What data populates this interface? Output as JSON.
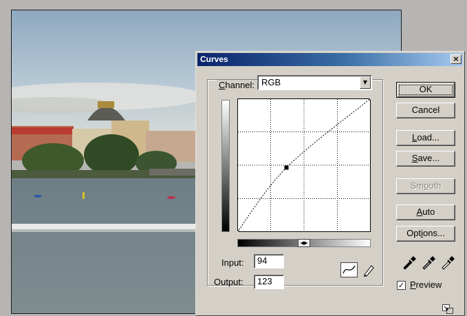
{
  "dialog": {
    "title": "Curves",
    "close_glyph": "×",
    "channel": {
      "label_prefix": "",
      "label_mnemonic": "C",
      "label_rest": "hannel:",
      "value": "RGB",
      "dropdown_glyph": "▼"
    },
    "input": {
      "label": "Input:",
      "value": "94"
    },
    "output": {
      "label": "Output:",
      "value": "123"
    },
    "gradient_toggle_glyph": "◀▶",
    "buttons": {
      "ok": "OK",
      "cancel": "Cancel",
      "load": {
        "mnemonic": "L",
        "rest": "oad..."
      },
      "save": {
        "mnemonic": "S",
        "rest": "ave..."
      },
      "smooth": {
        "pre": "Sm",
        "mnemonic": "o",
        "rest": "oth"
      },
      "auto": {
        "mnemonic": "A",
        "rest": "uto"
      },
      "options": {
        "pre": "Opt",
        "mnemonic": "i",
        "rest": "ons..."
      }
    },
    "preview": {
      "mnemonic": "P",
      "rest": "review",
      "checked": true,
      "check_glyph": "✓"
    },
    "curve_points": [
      {
        "input": 0,
        "output": 0
      },
      {
        "input": 94,
        "output": 123
      },
      {
        "input": 255,
        "output": 255
      }
    ],
    "icons": {
      "curve_tool": "curve-tool-icon",
      "pencil_tool": "pencil-tool-icon",
      "eyedropper_black": "eyedropper-black-icon",
      "eyedropper_gray": "eyedropper-gray-icon",
      "eyedropper_white": "eyedropper-white-icon",
      "resize": "resize-icon"
    }
  }
}
